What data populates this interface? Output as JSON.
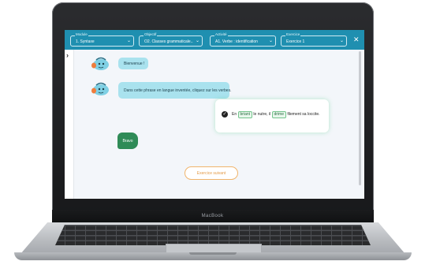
{
  "laptop": {
    "brand": "MacBook"
  },
  "header": {
    "selectors": [
      {
        "label": "Module",
        "value": "1. Syntaxe"
      },
      {
        "label": "Objectif",
        "value": "O2. Classes grammaticale..."
      },
      {
        "label": "Activité",
        "value": "A1. Verbe : identification"
      },
      {
        "label": "Exercice",
        "value": "Exercice 1"
      }
    ],
    "close_glyph": "✕",
    "chevron_glyph": "⌄"
  },
  "sidebar": {
    "expand_glyph": "›"
  },
  "chat": {
    "messages": [
      {
        "from": "bot",
        "text": "Bienvenue !"
      },
      {
        "from": "bot",
        "text": "Dans cette phrase en langue inventée, cliquez sur les verbes."
      }
    ],
    "exercise": {
      "sentence": {
        "w1": "En",
        "v1": "briant",
        "w2": "le nutre, il",
        "v2": "drime",
        "w3": "filement sa loccite."
      }
    },
    "feedback": "Bravo",
    "next_button": "Exercice suivant"
  },
  "colors": {
    "header_bg": "#1f8fb0",
    "bot_bubble": "#a9e2ee",
    "success": "#2f8b57",
    "accent_orange": "#e49a46"
  },
  "icons": [
    "chevron-down-icon",
    "close-icon",
    "expand-sidebar-icon",
    "check-circle-icon",
    "bot-avatar-icon"
  ]
}
